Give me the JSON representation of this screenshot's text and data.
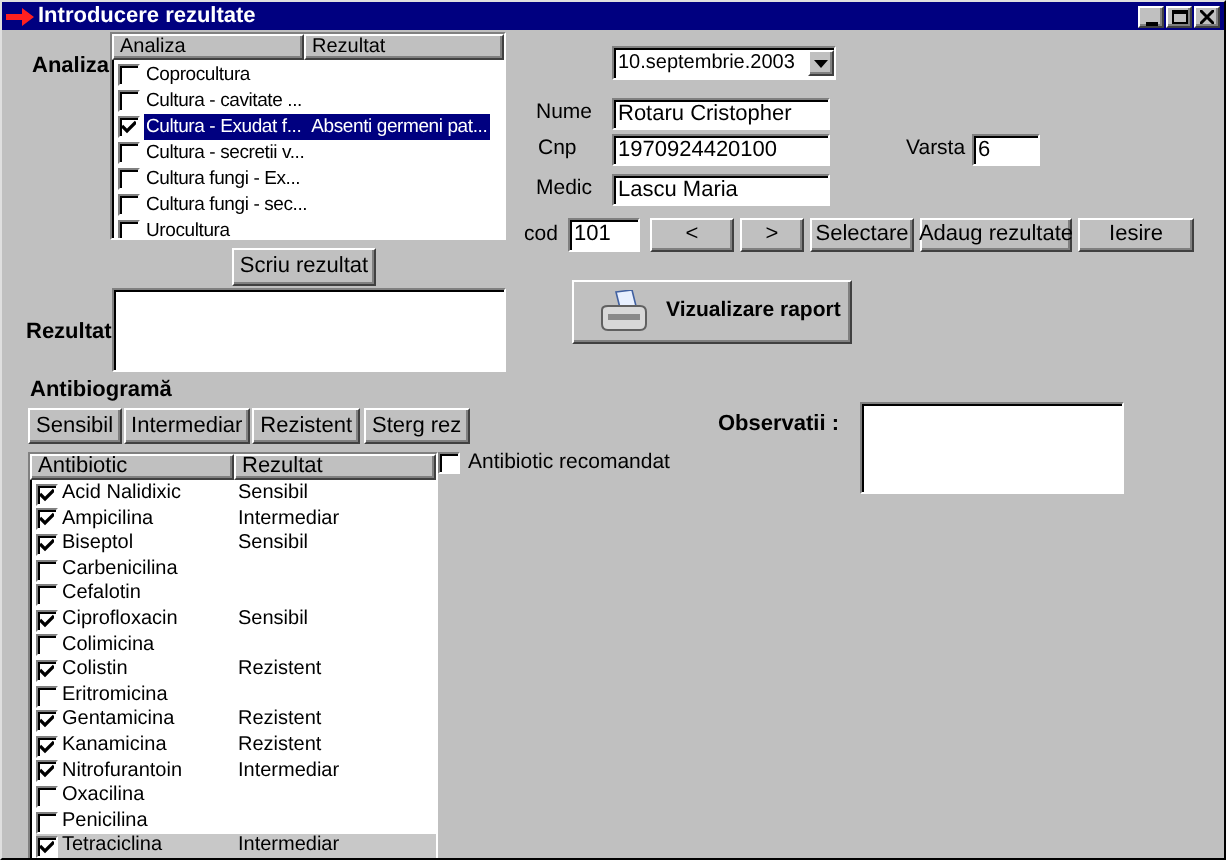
{
  "window": {
    "title": "Introducere rezultate"
  },
  "analiza": {
    "label": "Analiza",
    "columns": [
      "Analiza",
      "Rezultat"
    ],
    "rows": [
      {
        "name": "Coprocultura",
        "result": "",
        "checked": false,
        "selected": false
      },
      {
        "name": "Cultura - cavitate ...",
        "result": "",
        "checked": false,
        "selected": false
      },
      {
        "name": "Cultura - Exudat f...",
        "result": "Absenti germeni pat...",
        "checked": true,
        "selected": true
      },
      {
        "name": "Cultura - secretii v...",
        "result": "",
        "checked": false,
        "selected": false
      },
      {
        "name": "Cultura fungi - Ex...",
        "result": "",
        "checked": false,
        "selected": false
      },
      {
        "name": "Cultura fungi - sec...",
        "result": "",
        "checked": false,
        "selected": false
      },
      {
        "name": "Urocultura",
        "result": "",
        "checked": false,
        "selected": false
      }
    ]
  },
  "scriu_button": "Scriu rezultat",
  "rezultat": {
    "label": "Rezultat"
  },
  "antibiograma": {
    "title": "Antibiogramă",
    "buttons": [
      "Sensibil",
      "Intermediar",
      "Rezistent",
      "Sterg rez"
    ],
    "columns": [
      "Antibiotic",
      "Rezultat"
    ],
    "rows": [
      {
        "name": "Acid Nalidixic",
        "result": "Sensibil",
        "checked": true,
        "selected": false
      },
      {
        "name": "Ampicilina",
        "result": "Intermediar",
        "checked": true,
        "selected": false
      },
      {
        "name": "Biseptol",
        "result": "Sensibil",
        "checked": true,
        "selected": false
      },
      {
        "name": "Carbenicilina",
        "result": "",
        "checked": false,
        "selected": false
      },
      {
        "name": "Cefalotin",
        "result": "",
        "checked": false,
        "selected": false
      },
      {
        "name": "Ciprofloxacin",
        "result": "Sensibil",
        "checked": true,
        "selected": false
      },
      {
        "name": "Colimicina",
        "result": "",
        "checked": false,
        "selected": false
      },
      {
        "name": "Colistin",
        "result": "Rezistent",
        "checked": true,
        "selected": false
      },
      {
        "name": "Eritromicina",
        "result": "",
        "checked": false,
        "selected": false
      },
      {
        "name": "Gentamicina",
        "result": "Rezistent",
        "checked": true,
        "selected": false
      },
      {
        "name": "Kanamicina",
        "result": "Rezistent",
        "checked": true,
        "selected": false
      },
      {
        "name": "Nitrofurantoin",
        "result": "Intermediar",
        "checked": true,
        "selected": false
      },
      {
        "name": "Oxacilina",
        "result": "",
        "checked": false,
        "selected": false
      },
      {
        "name": "Penicilina",
        "result": "",
        "checked": false,
        "selected": false
      },
      {
        "name": "Tetraciclina",
        "result": "Intermediar",
        "checked": true,
        "selected": true
      }
    ]
  },
  "date": "10.septembrie.2003",
  "fields": {
    "nume": {
      "label": "Nume",
      "value": "Rotaru Cristopher"
    },
    "cnp": {
      "label": "Cnp",
      "value": "1970924420100"
    },
    "varsta": {
      "label": "Varsta",
      "value": "6"
    },
    "medic": {
      "label": "Medic",
      "value": "Lascu Maria"
    },
    "cod": {
      "label": "cod",
      "value": "101"
    }
  },
  "nav_buttons": [
    "<",
    ">",
    "Selectare",
    "Adaug rezultate",
    "Iesire"
  ],
  "report_button": "Vizualizare raport",
  "antibiotic_recomandat": {
    "label": "Antibiotic recomandat",
    "checked": false
  },
  "observatii": {
    "label": "Observatii :"
  }
}
